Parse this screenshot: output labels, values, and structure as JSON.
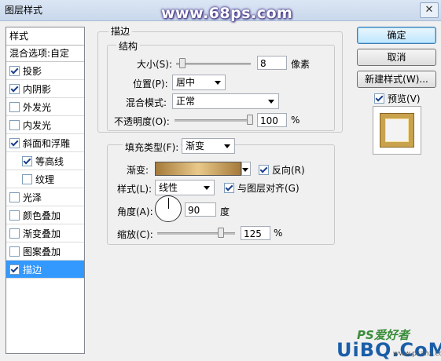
{
  "window": {
    "title": "图层样式",
    "watermark": "www.68ps.com",
    "close_label": "✕"
  },
  "sidebar": {
    "header": "样式",
    "blend_options": "混合选项:自定",
    "items": [
      {
        "label": "投影",
        "checked": true
      },
      {
        "label": "内阴影",
        "checked": true
      },
      {
        "label": "外发光",
        "checked": false
      },
      {
        "label": "内发光",
        "checked": false
      },
      {
        "label": "斜面和浮雕",
        "checked": true
      },
      {
        "label": "等高线",
        "checked": true,
        "sub": true
      },
      {
        "label": "纹理",
        "checked": false,
        "sub": true
      },
      {
        "label": "光泽",
        "checked": false
      },
      {
        "label": "颜色叠加",
        "checked": false
      },
      {
        "label": "渐变叠加",
        "checked": false
      },
      {
        "label": "图案叠加",
        "checked": false
      },
      {
        "label": "描边",
        "checked": true,
        "selected": true
      }
    ]
  },
  "panel": {
    "section_title": "描边",
    "structure": {
      "title": "结构",
      "size_label": "大小(S):",
      "size_value": "8",
      "size_unit": "像素",
      "position_label": "位置(P):",
      "position_value": "居中",
      "blend_label": "混合模式:",
      "blend_value": "正常",
      "opacity_label": "不透明度(O):",
      "opacity_value": "100",
      "opacity_unit": "%",
      "size_level": 0.08,
      "opacity_level": 1.0
    },
    "fill": {
      "type_label": "填充类型(F):",
      "type_value": "渐变",
      "gradient_label": "渐变:",
      "reverse_label": "反向(R)",
      "reverse_checked": true,
      "style_label": "样式(L):",
      "style_value": "线性",
      "align_label": "与图层对齐(G)",
      "align_checked": true,
      "angle_label": "角度(A):",
      "angle_value": "90",
      "angle_unit": "度",
      "scale_label": "缩放(C):",
      "scale_value": "125",
      "scale_unit": "%",
      "scale_level": 0.83
    }
  },
  "buttons": {
    "ok": "确定",
    "cancel": "取消",
    "new_style": "新建样式(W)...",
    "preview_label": "预览(V)",
    "preview_checked": true
  },
  "footer": {
    "logo": "PS爱好者",
    "url": "UiBQ.CoM",
    "sub": "www.psahz.com"
  },
  "colors": {
    "selection": "#3399ff",
    "gold": "#c9a24e"
  }
}
